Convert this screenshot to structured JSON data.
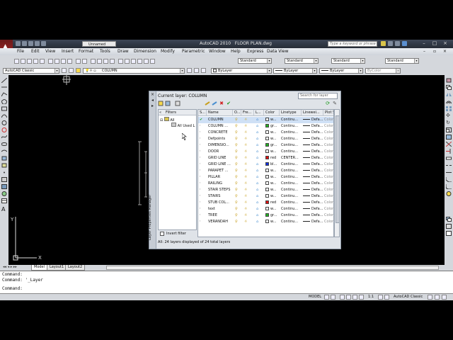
{
  "title": {
    "app": "AutoCAD 2010",
    "file": "FLOOR PLAN.dwg",
    "workspace": "Unnamed",
    "search_placeholder": "Type a keyword or phrase"
  },
  "menus": [
    "File",
    "Edit",
    "View",
    "Insert",
    "Format",
    "Tools",
    "Draw",
    "Dimension",
    "Modify",
    "Parametric",
    "Window",
    "Help",
    "Express",
    "Data View"
  ],
  "toolbar": {
    "workspace_combo": "AutoCAD Classic",
    "layer_combo": "COLUMN",
    "style_combos": [
      "Standard",
      "Standard",
      "Standard",
      "Standard"
    ],
    "color_combo": "ByLayer",
    "linetype_combo": "ByLayer",
    "lineweight_combo": "ByLayer",
    "plotstyle_combo": "ByColor"
  },
  "layer_manager": {
    "vertical_title": "Layer Properties Manager",
    "current_layer": "Current layer: COLUMN",
    "search_placeholder": "Search for layer",
    "filters_header": "Filters",
    "filter_all": "All",
    "filter_used": "All Used L",
    "invert_filter": "Invert filter",
    "status": "All: 24 layers displayed of 24 total layers",
    "columns": [
      "S...",
      "Name",
      "O...",
      "Fre...",
      "L...",
      "Color",
      "Linetype",
      "Linewei...",
      "Plot S..."
    ],
    "rows": [
      {
        "name": "COLUMN",
        "color_name": "w...",
        "color": "#ffffff",
        "linetype": "Continu...",
        "lw": "Defa...",
        "plot": "Color_...",
        "current": true
      },
      {
        "name": "COLUMN ...",
        "color_name": "gr...",
        "color": "#22b322",
        "linetype": "Continu...",
        "lw": "Defa...",
        "plot": "Color_..."
      },
      {
        "name": "CONCRETE",
        "color_name": "w...",
        "color": "#ffffff",
        "linetype": "Continu...",
        "lw": "Defa...",
        "plot": "Color_..."
      },
      {
        "name": "Defpoints",
        "color_name": "w...",
        "color": "#ffffff",
        "linetype": "Continu...",
        "lw": "Defa...",
        "plot": "Color_..."
      },
      {
        "name": "DIMENSIO...",
        "color_name": "gr...",
        "color": "#22b322",
        "linetype": "Continu...",
        "lw": "Defa...",
        "plot": "Color_..."
      },
      {
        "name": "DOOR",
        "color_name": "w...",
        "color": "#ffffff",
        "linetype": "Continu...",
        "lw": "Defa...",
        "plot": "Color_..."
      },
      {
        "name": "GRID LINE",
        "color_name": "red",
        "color": "#e01010",
        "linetype": "CENTER...",
        "lw": "Defa...",
        "plot": "Color_..."
      },
      {
        "name": "GRID LINE ...",
        "color_name": "bl...",
        "color": "#1030e0",
        "linetype": "Continu...",
        "lw": "Defa...",
        "plot": "Color_..."
      },
      {
        "name": "PARAPET ...",
        "color_name": "w...",
        "color": "#ffffff",
        "linetype": "Continu...",
        "lw": "Defa...",
        "plot": "Color_..."
      },
      {
        "name": "PILLAR",
        "color_name": "w...",
        "color": "#ffffff",
        "linetype": "Continu...",
        "lw": "Defa...",
        "plot": "Color_..."
      },
      {
        "name": "RAILING",
        "color_name": "w...",
        "color": "#ffffff",
        "linetype": "Continu...",
        "lw": "Defa...",
        "plot": "Color_..."
      },
      {
        "name": "STAIR STEPS",
        "color_name": "w...",
        "color": "#ffffff",
        "linetype": "Continu...",
        "lw": "Defa...",
        "plot": "Color_..."
      },
      {
        "name": "STAIRS",
        "color_name": "w...",
        "color": "#ffffff",
        "linetype": "Continu...",
        "lw": "Defa...",
        "plot": "Color_..."
      },
      {
        "name": "STUB COL...",
        "color_name": "red",
        "color": "#e01010",
        "linetype": "Continu...",
        "lw": "Defa...",
        "plot": "Color_..."
      },
      {
        "name": "text",
        "color_name": "w...",
        "color": "#ffffff",
        "linetype": "Continu...",
        "lw": "Defa...",
        "plot": "Color_..."
      },
      {
        "name": "TREE",
        "color_name": "gr...",
        "color": "#22b322",
        "linetype": "Continu...",
        "lw": "Defa...",
        "plot": "Color_..."
      },
      {
        "name": "VERANDAH",
        "color_name": "w...",
        "color": "#ffffff",
        "linetype": "Continu...",
        "lw": "Defa...",
        "plot": "Color_..."
      }
    ]
  },
  "tabs": [
    "Model",
    "Layout1",
    "Layout2"
  ],
  "command": {
    "line1": "Command:",
    "line2": "Command: '_Layer",
    "prompt": "Command:"
  },
  "status": {
    "model": "MODEL",
    "scale": "1:1",
    "workspace": "AutoCAD Classic"
  },
  "axis": {
    "x": "X",
    "y": "Y"
  }
}
